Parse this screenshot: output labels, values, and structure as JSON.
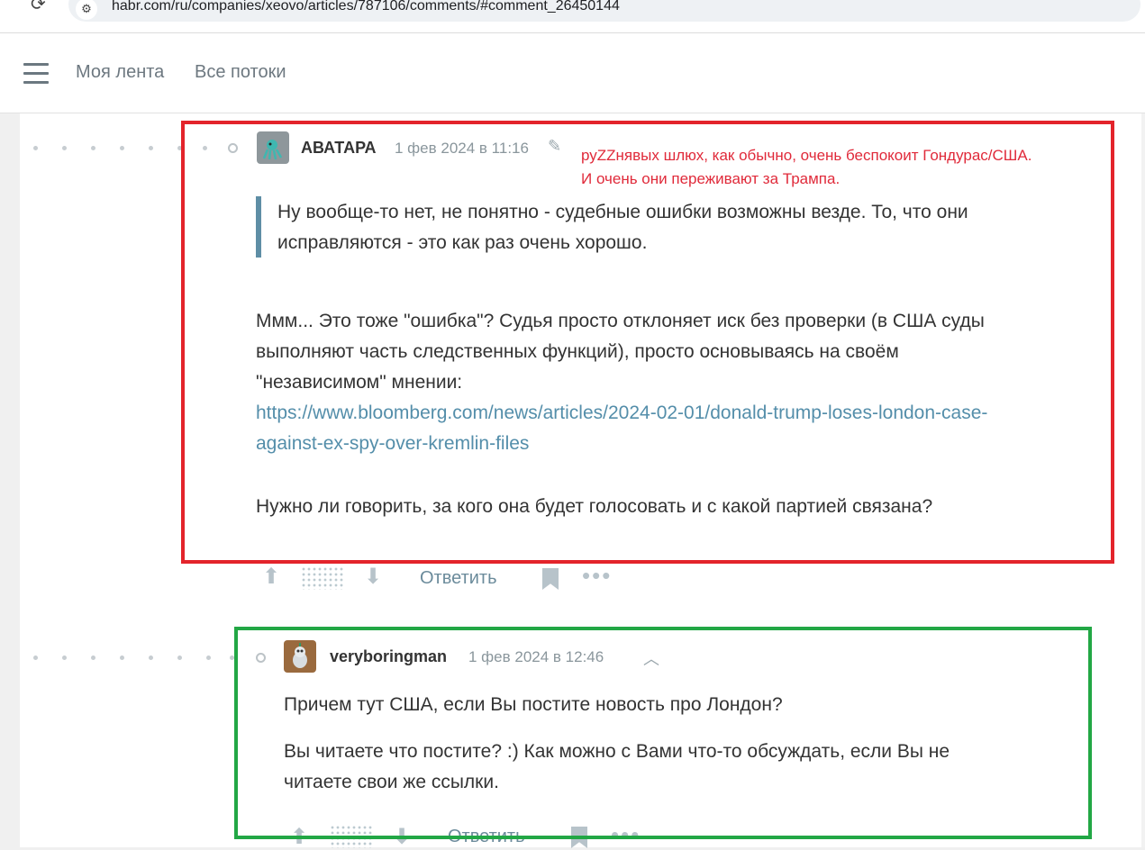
{
  "browser": {
    "url": "habr.com/ru/companies/xeovo/articles/787106/comments/#comment_26450144"
  },
  "header": {
    "nav": [
      "Моя лента",
      "Все потоки"
    ]
  },
  "annotation": {
    "line1": "руZZнявых шлюх, как обычно, очень беспокоит Гондурас/США.",
    "line2": "И очень они переживают за Трампа."
  },
  "comment1": {
    "author": "АВАТАРА",
    "time": "1 фев 2024 в 11:16",
    "quote_line1": "Ну вообще-то нет, не понятно - судебные ошибки возможны везде. То, что они",
    "quote_line2": "исправляются - это как раз очень хорошо.",
    "para_line1": "Ммм... Это тоже \"ошибка\"? Судья просто отклоняет иск без проверки (в США суды",
    "para_line2": "выполняют часть следственных функций), просто основываясь на своём",
    "para_line3": "\"независимом\" мнении:",
    "link_line1": "https://www.bloomberg.com/news/articles/2024-02-01/donald-trump-loses-london-case-",
    "link_line2": "against-ex-spy-over-kremlin-files",
    "question": "Нужно ли говорить, за кого она будет голосовать и с какой партией связана?",
    "reply_label": "Ответить"
  },
  "comment2": {
    "author": "veryboringman",
    "time": "1 фев 2024 в 12:46",
    "line1": "Причем тут США, если Вы постите новость про Лондон?",
    "line2": "Вы читаете что постите? :) Как можно с Вами что-то обсуждать, если Вы не",
    "line3": "читаете свои же ссылки.",
    "reply_label": "Ответить"
  },
  "colors": {
    "highlight_red": "#e3242b",
    "highlight_green": "#22a745",
    "link": "#548eaa"
  }
}
